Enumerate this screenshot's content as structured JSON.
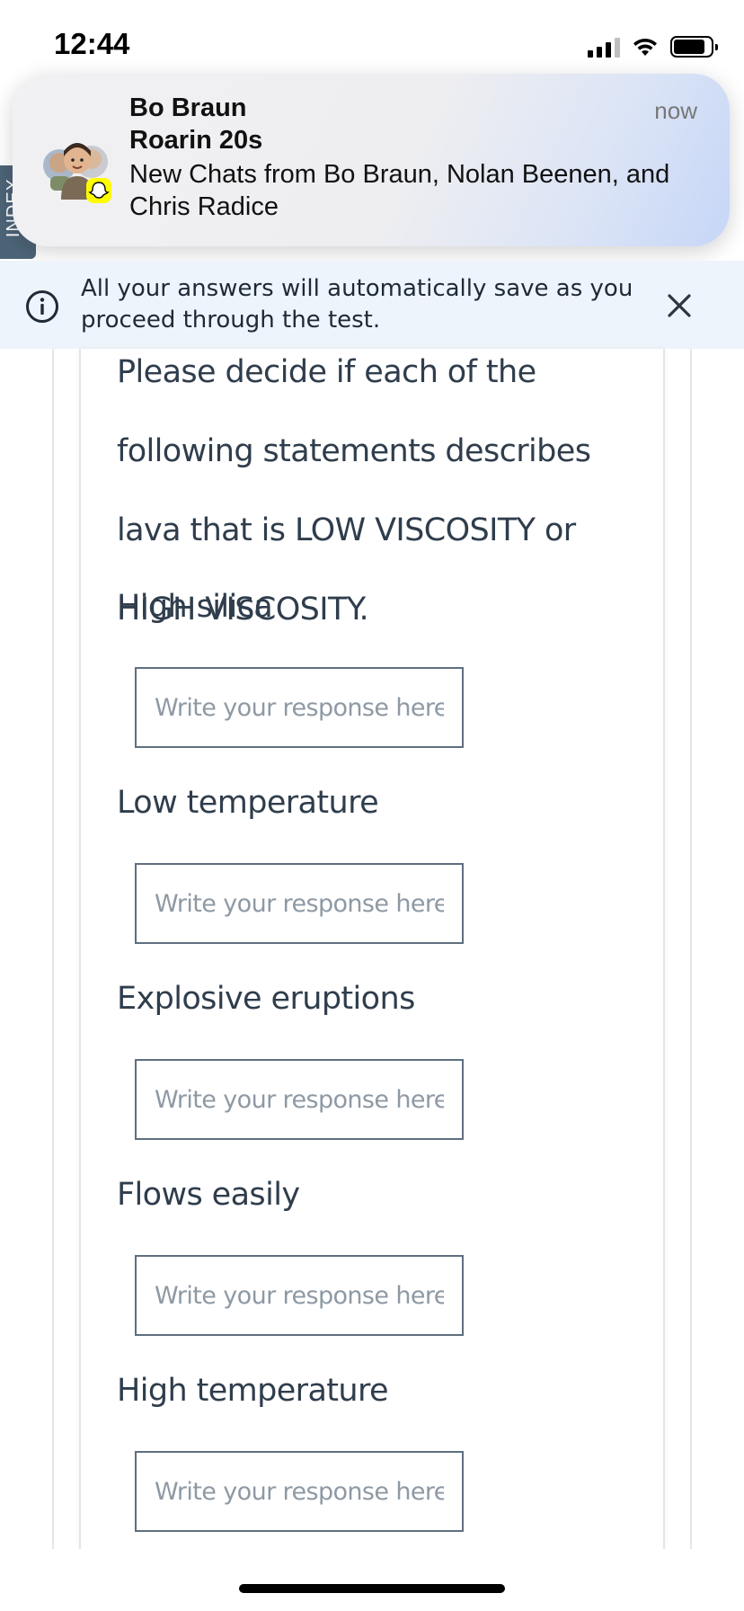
{
  "status_bar": {
    "time": "12:44"
  },
  "notification": {
    "title": "Bo Braun",
    "subtitle": "Roarin 20s",
    "body": "New Chats from Bo Braun, Nolan Beenen, and Chris Radice",
    "time": "now",
    "app_icon": "snapchat-ghost-icon"
  },
  "side_tab": {
    "label": "INDEX"
  },
  "banner": {
    "text": "All your answers will automatically save as you proceed through the test."
  },
  "question": {
    "prompt": "Please decide if each of the following statements describes lava that is LOW VISCOSITY or HIGH VISCOSITY.",
    "items": [
      {
        "label": "High silica",
        "value": "",
        "placeholder": "Write your response here..."
      },
      {
        "label": "Low temperature",
        "value": "",
        "placeholder": "Write your response here..."
      },
      {
        "label": "Explosive eruptions",
        "value": "",
        "placeholder": "Write your response here..."
      },
      {
        "label": "Flows easily",
        "value": "",
        "placeholder": "Write your response here..."
      },
      {
        "label": "High temperature",
        "value": "",
        "placeholder": "Write your response here..."
      }
    ]
  },
  "colors": {
    "banner_bg": "#eef4fb",
    "text": "#2f3d4c",
    "input_border": "#5e6f7f",
    "tab_bg": "#4d6478"
  }
}
